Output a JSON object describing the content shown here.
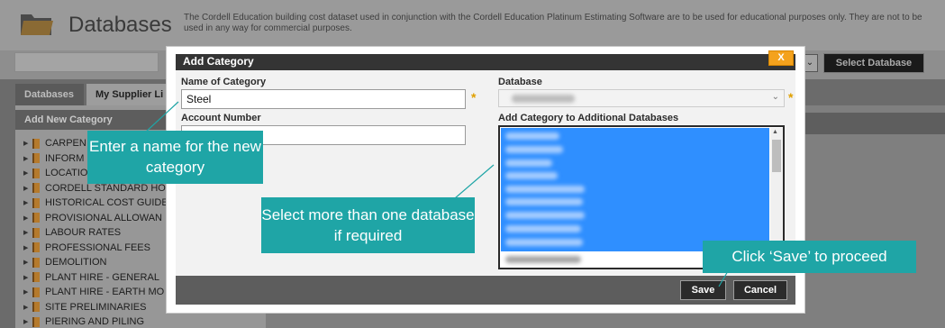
{
  "app": {
    "title": "Databases",
    "description": "The Cordell Education building cost dataset used in conjunction with the Cordell Education Platinum Estimating Software are to be used for educational purposes only. They are not to be used in any way for commercial purposes.",
    "select_database_label": "Select Database",
    "select_chevron": "⌄"
  },
  "tabs": [
    {
      "label": "Databases"
    },
    {
      "label": "My Supplier Li"
    }
  ],
  "left_panel": {
    "header": "Add New Category",
    "tree_arrow": "▶",
    "items": [
      {
        "label": "CARPEN"
      },
      {
        "label": "INFORM"
      },
      {
        "label": "LOCATIO"
      },
      {
        "label": "CORDELL STANDARD HO"
      },
      {
        "label": "HISTORICAL COST GUIDE"
      },
      {
        "label": "PROVISIONAL ALLOWAN"
      },
      {
        "label": "LABOUR RATES"
      },
      {
        "label": "PROFESSIONAL FEES"
      },
      {
        "label": "DEMOLITION"
      },
      {
        "label": "PLANT HIRE - GENERAL"
      },
      {
        "label": "PLANT HIRE - EARTH MO"
      },
      {
        "label": "SITE PRELIMINARIES"
      },
      {
        "label": "PIERING AND PILING"
      }
    ]
  },
  "modal": {
    "title": "Add Category",
    "close_label": "X",
    "name_label": "Name of Category",
    "name_value": "Steel",
    "account_label": "Account Number",
    "account_value": "",
    "database_label": "Database",
    "database_chevron": "⌄",
    "additional_label": "Add Category to Additional Databases",
    "required_mark": "*",
    "scroll_up": "▲",
    "scroll_down": "▼",
    "save_label": "Save",
    "cancel_label": "Cancel"
  },
  "callouts": {
    "name_hint": "Enter a name for the new category",
    "db_hint": "Select more than one database if required",
    "save_hint": "Click ‘Save’ to proceed"
  },
  "colors": {
    "callout": "#1fa5a6",
    "selection": "#2f8fff",
    "close_button": "#f4a21d"
  }
}
